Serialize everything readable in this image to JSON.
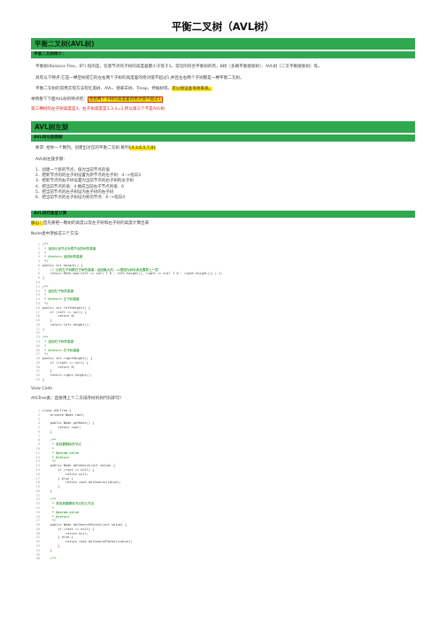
{
  "doc_title": "平衡二叉树（AVL树）",
  "section1": {
    "heading": "平衡二叉树(AVL树)",
    "sub_heading": "平衡二叉树简介：",
    "p1": "平衡树(Balance Tree，BT) 指的是，任意节点的子树的高度差都小于等于1。常见的符合平衡树的有，B树（多路平衡搜索树）、AVL树（二叉平衡搜索树）等。",
    "p2": "具有以下特点:它是一棵空树或它的左右两个子树的高度差的绝对值不超过1,并且左右两个子树都是一棵平衡二叉树。",
    "p3_pre": "平衡二叉树的常用实现方法有红黑树、AVL、替罪羊树、Treap、伸展树等。",
    "p3_hl": "可以保证查询效率高。",
    "p4_pre": "举例看下下面AVL树的特点吧：",
    "p4_hl": "左右两个子树的高度差的绝对值不超过1",
    "p5": "第三棵树的左子树高度是3，右子树高度是1,3-1=2,所以第三个不是AVL树"
  },
  "section2": {
    "heading": "AVL树左旋",
    "sub_heading": "AVL树左旋图解",
    "req_pre": "要求: 给你一个数列，创建出对应的平衡二叉树.数列",
    "req_hl": "{4,3,6,5,7,8}",
    "steps_title": "AVL树左旋步骤:",
    "steps": [
      "1．创建一个新的节点，值为当前节点的值",
      "2．把新节点的的左子树设置为原节点的左子树：4-->指向3",
      "3．把新节点的右子树设置为当前节点的右子树的左子树",
      "4．把当前节点的值：4 换成当前右子节点的值：6",
      "5．把当前节点的右子树设为右子树的右子树",
      "6．把当前节点的左子树设为新的节点：6-->指向4"
    ]
  },
  "section3": {
    "sub_heading": "AVL树的高度计算",
    "line1_hl": "核心：",
    "line1_rest": "首先要把一颗树的高度以及左子树和右子树的高度计算出来",
    "line2": "Node类中添加这三个方法:",
    "view_code": "View Code",
    "line3": "AVLTree类：直接用上个二叉排序树的树代码即可！"
  },
  "code1": [
    "/**",
    " * 返回以该节点为根节点的树的高度",
    " *",
    " * @return 返回树的高度",
    " */",
    "public int height() {",
    "    // 比较左子树跟右子树的高度，返回最大的。+1是因为树本身还要算上一层",
    "    return Math.max(left == null ? 0 : left.height(), right == null ? 0 : right.height()) + 1;",
    "}",
    "",
    "/**",
    " * 返回左子树的高度",
    " *",
    " * @return 左子树高度",
    " */",
    "public int leftHeight() {",
    "    if (left == null) {",
    "        return 0;",
    "    }",
    "    return left.height();",
    "}",
    "",
    "/**",
    " * 返回右子树的高度",
    " *",
    " * @return 右子树高度",
    " */",
    "public int rightHeight() {",
    "    if (right == null) {",
    "        return 0;",
    "    }",
    "    return right.height();",
    "}"
  ],
  "code2": [
    "class AVLTree {",
    "    private Node root;",
    "",
    "    public Node getRoot() {",
    "        return root;",
    "    }",
    "",
    "    /**",
    "     * 查找要删除的节点",
    "     *",
    "     * @param value",
    "     * @return",
    "     */",
    "    public Node delSearch(int value) {",
    "        if (root == null) {",
    "            return null;",
    "        } else {",
    "            return root.delSearch(value);",
    "        }",
    "    }",
    "",
    "    /**",
    "     * 查找到要删除节点的父节点",
    "     *",
    "     * @param value",
    "     * @return",
    "     */",
    "    public Node delSearchParent(int value) {",
    "        if (root == null) {",
    "            return null;",
    "        } else {",
    "            return root.delSearchParent(value);",
    "        }",
    "    }",
    "",
    "    /**"
  ]
}
